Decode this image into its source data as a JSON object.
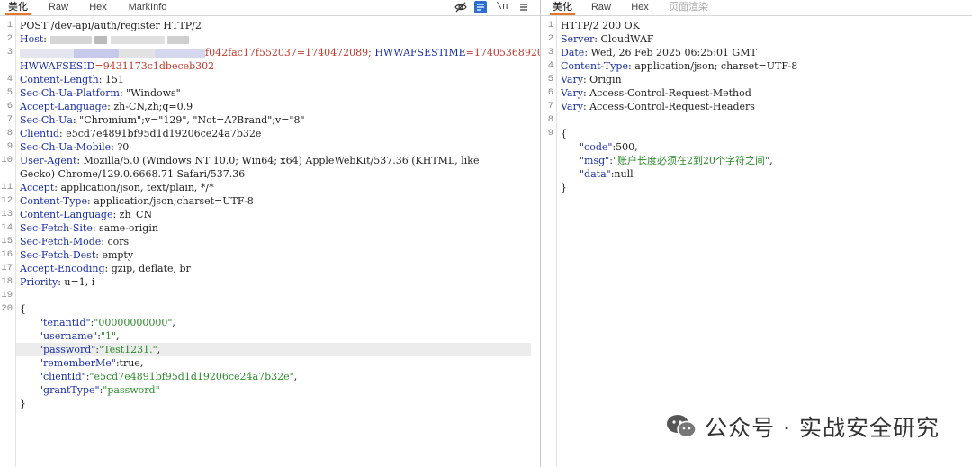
{
  "request": {
    "tabs": [
      "美化",
      "Raw",
      "Hex",
      "MarkInfo"
    ],
    "toolbar": {
      "newline_label": "\\n"
    },
    "lines": [
      {
        "n": "1",
        "text": "POST /dev-api/auth/register HTTP/2"
      },
      {
        "n": "2",
        "key": "Host",
        "text": ":"
      },
      {
        "n": "3",
        "key": "",
        "text": "f042fac17f552037=1740472089; ",
        "key2": "HWWAFSESTIME",
        "text2": "=1740536892092;"
      },
      {
        "n": "",
        "key": "HWWAFSESID",
        "text": "=9431173c1dbeceb302"
      },
      {
        "n": "4",
        "key": "Content-Length",
        "text": ": 151"
      },
      {
        "n": "5",
        "key": "Sec-Ch-Ua-Platform",
        "text": ": \"Windows\""
      },
      {
        "n": "6",
        "key": "Accept-Language",
        "text": ": zh-CN,zh;q=0.9"
      },
      {
        "n": "7",
        "key": "Sec-Ch-Ua",
        "text": ": \"Chromium\";v=\"129\", \"Not=A?Brand\";v=\"8\""
      },
      {
        "n": "8",
        "key": "Clientid",
        "text": ": e5cd7e4891bf95d1d19206ce24a7b32e"
      },
      {
        "n": "9",
        "key": "Sec-Ch-Ua-Mobile",
        "text": ": ?0"
      },
      {
        "n": "10",
        "key": "User-Agent",
        "text": ": Mozilla/5.0 (Windows NT 10.0; Win64; x64) AppleWebKit/537.36 (KHTML, like"
      },
      {
        "n": "",
        "key": "",
        "text": "Gecko) Chrome/129.0.6668.71 Safari/537.36"
      },
      {
        "n": "11",
        "key": "Accept",
        "text": ": application/json, text/plain, */*"
      },
      {
        "n": "12",
        "key": "Content-Type",
        "text": ": application/json;charset=UTF-8"
      },
      {
        "n": "13",
        "key": "Content-Language",
        "text": ": zh_CN"
      },
      {
        "n": "14",
        "key": "Sec-Fetch-Site",
        "text": ": same-origin"
      },
      {
        "n": "15",
        "key": "Sec-Fetch-Mode",
        "text": ": cors"
      },
      {
        "n": "16",
        "key": "Sec-Fetch-Dest",
        "text": ": empty"
      },
      {
        "n": "17",
        "key": "Accept-Encoding",
        "text": ": gzip, deflate, br"
      },
      {
        "n": "18",
        "key": "Priority",
        "text": ": u=1, i"
      },
      {
        "n": "19",
        "key": "",
        "text": ""
      },
      {
        "n": "20",
        "key": "",
        "text": "{"
      },
      {
        "n": "",
        "json": true,
        "k": "\"tenantId\"",
        "v": "\"00000000000\"",
        "s": true,
        "tail": ","
      },
      {
        "n": "",
        "json": true,
        "k": "\"username\"",
        "v": "\"1\"",
        "s": true,
        "tail": ","
      },
      {
        "n": "",
        "json": true,
        "k": "\"password\"",
        "v": "\"Test1231.\"",
        "s": true,
        "tail": ",",
        "highlight": true
      },
      {
        "n": "",
        "json": true,
        "k": "\"rememberMe\"",
        "v": "true",
        "s": false,
        "tail": ","
      },
      {
        "n": "",
        "json": true,
        "k": "\"clientId\"",
        "v": "\"e5cd7e4891bf95d1d19206ce24a7b32e\"",
        "s": true,
        "tail": ","
      },
      {
        "n": "",
        "json": true,
        "k": "\"grantType\"",
        "v": "\"password\"",
        "s": true,
        "tail": ""
      },
      {
        "n": "",
        "key": "",
        "text": "}"
      }
    ]
  },
  "response": {
    "tabs": [
      "美化",
      "Raw",
      "Hex",
      "页面渲染"
    ],
    "lines": [
      {
        "n": "1",
        "text": "HTTP/2 200 OK"
      },
      {
        "n": "2",
        "key": "Server",
        "text": ": CloudWAF"
      },
      {
        "n": "3",
        "key": "Date",
        "text": ": Wed, 26 Feb 2025 06:25:01 GMT"
      },
      {
        "n": "4",
        "key": "Content-Type",
        "text": ": application/json; charset=UTF-8"
      },
      {
        "n": "5",
        "key": "Vary",
        "text": ": Origin"
      },
      {
        "n": "6",
        "key": "Vary",
        "text": ": Access-Control-Request-Method"
      },
      {
        "n": "7",
        "key": "Vary",
        "text": ": Access-Control-Request-Headers"
      },
      {
        "n": "8",
        "key": "",
        "text": ""
      },
      {
        "n": "9",
        "key": "",
        "text": "{"
      },
      {
        "n": "",
        "json": true,
        "k": "\"code\"",
        "v": "500",
        "s": false,
        "tail": ","
      },
      {
        "n": "",
        "json": true,
        "k": "\"msg\"",
        "v": "\"账户长度必须在2到20个字符之间\"",
        "s": true,
        "tail": ","
      },
      {
        "n": "",
        "json": true,
        "k": "\"data\"",
        "v": "null",
        "s": false,
        "tail": ""
      },
      {
        "n": "",
        "key": "",
        "text": "}"
      }
    ]
  },
  "watermark": {
    "text": "公众号 · 实战安全研究",
    "icon": "wechat-icon"
  }
}
